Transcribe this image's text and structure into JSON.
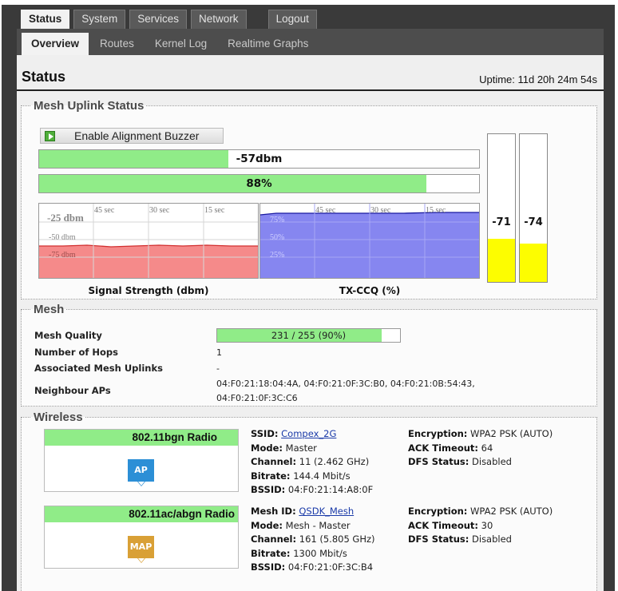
{
  "nav": {
    "top_tabs": [
      "Status",
      "System",
      "Services",
      "Network"
    ],
    "logout": "Logout",
    "sub_tabs": [
      "Overview",
      "Routes",
      "Kernel Log",
      "Realtime Graphs"
    ]
  },
  "header": {
    "title": "Status",
    "uptime": "Uptime: 11d 20h 24m 54s"
  },
  "uplink": {
    "legend": "Mesh Uplink Status",
    "buzzer_label": "Enable Alignment Buzzer",
    "signal_bar": {
      "text": "-57dbm",
      "fill_fraction": 0.43
    },
    "ccq_bar": {
      "text": "88%",
      "fill_fraction": 0.88
    },
    "signal_graph": {
      "caption": "Signal Strength (dbm)",
      "time_labels": [
        "45 sec",
        "30 sec",
        "15 sec"
      ],
      "y_labels": [
        "-25 dbm",
        "-50 dbm",
        "-75 dbm"
      ],
      "color": "#f58a8a"
    },
    "ccq_graph": {
      "caption": "TX-CCQ (%)",
      "time_labels": [
        "45 sec",
        "30 sec",
        "15 sec"
      ],
      "y_labels": [
        "75%",
        "50%",
        "25%"
      ],
      "color": "#8686f0"
    },
    "chains": [
      {
        "value": "-71",
        "fill_fraction": 0.29
      },
      {
        "value": "-74",
        "fill_fraction": 0.26
      }
    ]
  },
  "mesh": {
    "legend": "Mesh",
    "quality_label": "Mesh Quality",
    "quality_text": "231 / 255 (90%)",
    "quality_fraction": 0.9,
    "hops_label": "Number of Hops",
    "hops_value": "1",
    "uplinks_label": "Associated Mesh Uplinks",
    "uplinks_value": "-",
    "neighbours_label": "Neighbour APs",
    "neighbours_line1": "04:F0:21:18:04:4A, 04:F0:21:0F:3C:B0, 04:F0:21:0B:54:43,",
    "neighbours_line2": "04:F0:21:0F:3C:C6"
  },
  "wireless": {
    "legend": "Wireless",
    "radios": [
      {
        "title": "802.11bgn Radio",
        "badge": "AP",
        "badge_color": "#2c8fd6",
        "id_label": "SSID:",
        "id_value": "Compex_2G",
        "mode_label": "Mode:",
        "mode_value": "Master",
        "channel_label": "Channel:",
        "channel_value": "11 (2.462 GHz)",
        "bitrate_label": "Bitrate:",
        "bitrate_value": "144.4 Mbit/s",
        "bssid_label": "BSSID:",
        "bssid_value": "04:F0:21:14:A8:0F",
        "enc_label": "Encryption:",
        "enc_value": "WPA2 PSK (AUTO)",
        "ack_label": "ACK Timeout:",
        "ack_value": "64",
        "dfs_label": "DFS Status:",
        "dfs_value": "Disabled"
      },
      {
        "title": "802.11ac/abgn Radio",
        "badge": "MAP",
        "badge_color": "#d9a036",
        "id_label": "Mesh ID:",
        "id_value": "QSDK_Mesh",
        "mode_label": "Mode:",
        "mode_value": "Mesh - Master",
        "channel_label": "Channel:",
        "channel_value": "161 (5.805 GHz)",
        "bitrate_label": "Bitrate:",
        "bitrate_value": "1300 Mbit/s",
        "bssid_label": "BSSID:",
        "bssid_value": "04:F0:21:0F:3C:B4",
        "enc_label": "Encryption:",
        "enc_value": "WPA2 PSK (AUTO)",
        "ack_label": "ACK Timeout:",
        "ack_value": "30",
        "dfs_label": "DFS Status:",
        "dfs_value": "Disabled"
      }
    ]
  }
}
